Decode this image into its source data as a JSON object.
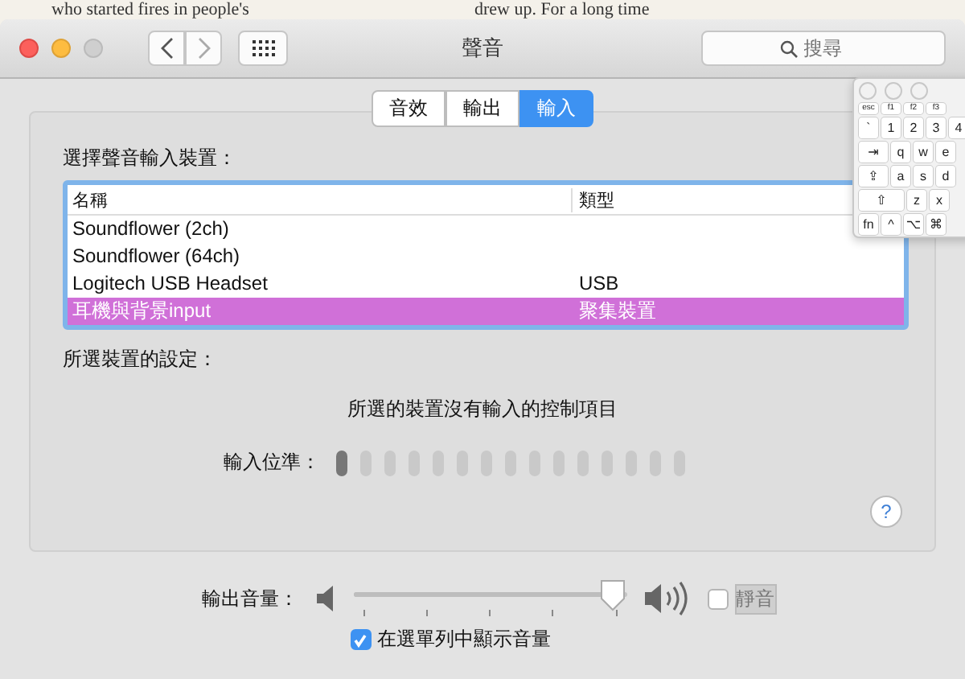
{
  "background_window": {
    "texts": [
      "who started fires in people's",
      "drew up. For a long time"
    ]
  },
  "window": {
    "title": "聲音",
    "search": {
      "placeholder": "搜尋"
    }
  },
  "tabs": [
    {
      "label": "音效",
      "selected": false
    },
    {
      "label": "輸出",
      "selected": false
    },
    {
      "label": "輸入",
      "selected": true
    }
  ],
  "device_list": {
    "heading": "選擇聲音輸入裝置：",
    "columns": [
      "名稱",
      "類型"
    ],
    "rows": [
      {
        "name": "Soundflower (2ch)",
        "type": "",
        "selected": false
      },
      {
        "name": "Soundflower (64ch)",
        "type": "",
        "selected": false
      },
      {
        "name": "Logitech USB Headset",
        "type": "USB",
        "selected": false
      },
      {
        "name": "耳機與背景input",
        "type": "聚集裝置",
        "selected": true
      }
    ]
  },
  "settings": {
    "heading": "所選裝置的設定：",
    "message": "所選的裝置沒有輸入的控制項目",
    "input_level_label": "輸入位準：",
    "input_level": {
      "level": 0.07
    }
  },
  "help_button": "?",
  "output_volume": {
    "label": "輸出音量：",
    "level": 0.95,
    "mute_label": "靜音",
    "muted": false
  },
  "show_in_menu_bar": {
    "label": "在選單列中顯示音量",
    "checked": true
  },
  "keyboard_viewer": {
    "rows": [
      [
        "esc",
        "f1",
        "f2",
        "f3"
      ],
      [
        "`",
        "1",
        "2",
        "3",
        "4"
      ],
      [
        "⇥",
        "q",
        "w",
        "e"
      ],
      [
        "⇪",
        "a",
        "s",
        "d"
      ],
      [
        "⇧",
        "z",
        "x"
      ],
      [
        "fn",
        "^",
        "⌥",
        "⌘"
      ]
    ]
  }
}
